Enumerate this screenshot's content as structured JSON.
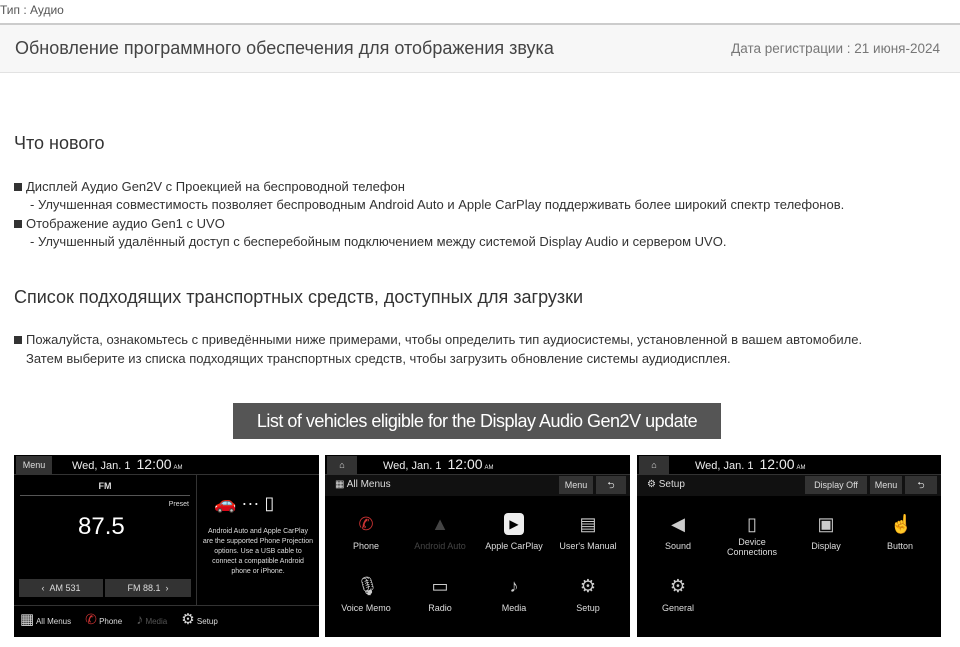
{
  "type_label": "Тип : Аудио",
  "header": {
    "title": "Обновление программного обеспечения для отображения звука",
    "date": "Дата регистрации : 21 июня-2024"
  },
  "whats_new": {
    "heading": "Что нового",
    "items": [
      {
        "title": "Дисплей Аудио Gen2V с Проекцией на беспроводной телефон",
        "detail": "-  Улучшенная совместимость позволяет беспроводным Android Auto и Apple CarPlay поддерживать более широкий спектр телефонов."
      },
      {
        "title": "Отображение аудио Gen1 с UVO",
        "detail": "-  Улучшенный удалённый доступ с бесперебойным подключением между системой Display Audio и сервером UVO."
      }
    ]
  },
  "eligible": {
    "heading": "Список подходящих транспортных средств, доступных для загрузки",
    "line1": "Пожалуйста, ознакомьтесь с приведёнными ниже примерами, чтобы определить тип аудиосистемы, установленной в вашем автомобиле.",
    "line2": "Затем выберите из списка подходящих транспортных средств, чтобы загрузить обновление системы аудиодисплея.",
    "banner": "List of vehicles eligible for the Display Audio Gen2V update"
  },
  "clock": {
    "date": "Wed, Jan. 1",
    "time": "12:00",
    "ampm": "AM"
  },
  "screen1": {
    "menu": "Menu",
    "band": "FM",
    "preset": "Preset",
    "freq": "87.5",
    "prev": "AM 531",
    "next": "FM 88.1",
    "info": "Android Auto and Apple CarPlay are the supported Phone Projection options. Use a USB cable to connect a compatible Android phone or iPhone.",
    "dock": [
      "All Menus",
      "Phone",
      "Media",
      "Setup"
    ]
  },
  "screen2": {
    "title": "All Menus",
    "menu": "Menu",
    "tiles": [
      "Phone",
      "Android Auto",
      "Apple CarPlay",
      "User's Manual",
      "Voice Memo",
      "Radio",
      "Media",
      "Setup"
    ]
  },
  "screen3": {
    "title": "Setup",
    "display_off": "Display Off",
    "menu": "Menu",
    "tiles": [
      "Sound",
      "Device Connections",
      "Display",
      "Button",
      "General"
    ]
  }
}
